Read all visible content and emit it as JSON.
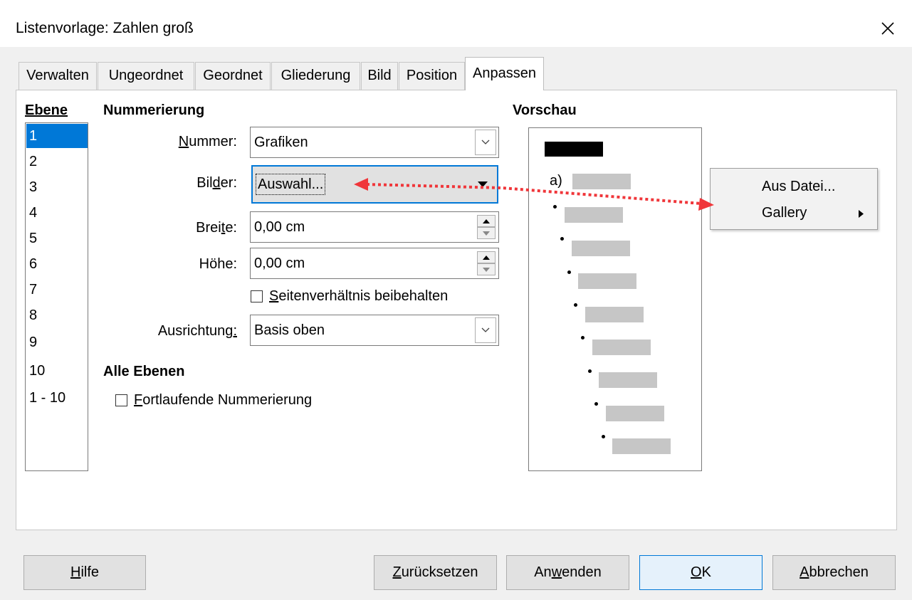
{
  "window": {
    "title": "Listenvorlage: Zahlen groß",
    "close_icon": "close-icon"
  },
  "tabs": [
    {
      "label": "Verwalten"
    },
    {
      "label": "Ungeordnet"
    },
    {
      "label": "Geordnet"
    },
    {
      "label": "Gliederung"
    },
    {
      "label": "Bild"
    },
    {
      "label": "Position"
    },
    {
      "label": "Anpassen",
      "active": true
    }
  ],
  "level": {
    "heading": "Ebene",
    "items": [
      "1",
      "2",
      "3",
      "4",
      "5",
      "6",
      "7",
      "8",
      "9",
      "10",
      "1 - 10"
    ],
    "selected": "1"
  },
  "numbering": {
    "heading": "Nummerierung",
    "number_label_u": "N",
    "number_label_rest": "ummer:",
    "number_value": "Grafiken",
    "images_label_pre": "Bil",
    "images_label_u": "d",
    "images_label_rest": "er:",
    "images_value": "Auswahl...",
    "width_label_pre": "Brei",
    "width_label_u": "t",
    "width_label_rest": "e:",
    "width_value": "0,00 cm",
    "height_label": "Höhe:",
    "height_value": "0,00 cm",
    "keep_ratio_u": "S",
    "keep_ratio_rest": "eitenverhältnis beibehalten",
    "keep_ratio_checked": false,
    "alignment_label_pre": "Ausrichtung",
    "alignment_label_u": ":",
    "alignment_value": "Basis oben"
  },
  "all_levels": {
    "heading": "Alle Ebenen",
    "consecutive_u": "F",
    "consecutive_rest": "ortlaufende Nummerierung",
    "consecutive_checked": false
  },
  "preview": {
    "heading": "Vorschau",
    "first_label": "a)"
  },
  "context_menu": {
    "items": [
      {
        "label": "Aus Datei..."
      },
      {
        "label": "Gallery",
        "has_submenu": true
      }
    ]
  },
  "buttons": {
    "help_u": "H",
    "help_rest": "ilfe",
    "reset_u": "Z",
    "reset_rest": "urücksetzen",
    "apply_pre": "An",
    "apply_u": "w",
    "apply_rest": "enden",
    "ok_u": "O",
    "ok_rest": "K",
    "cancel_u": "A",
    "cancel_rest": "bbrechen"
  },
  "colors": {
    "accent": "#0078d7",
    "annotation_arrow": "#f0363a"
  }
}
